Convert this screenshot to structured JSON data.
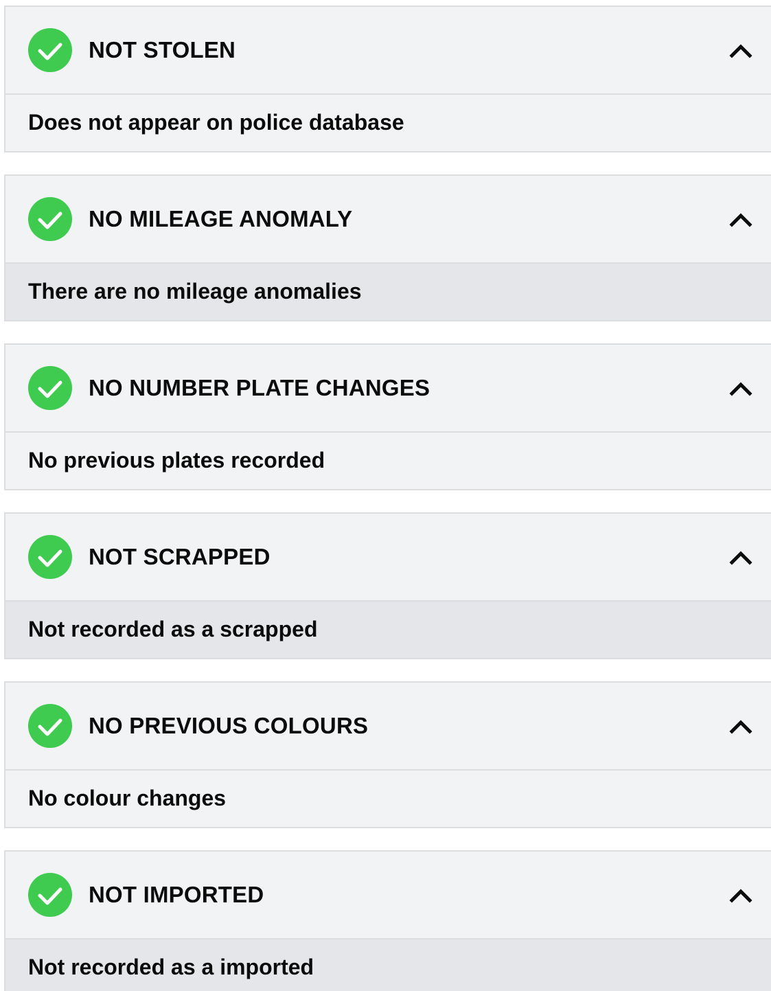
{
  "colors": {
    "check_green": "#3ecb4f",
    "header_bg": "#f2f3f5",
    "body_shaded_bg": "#e5e6e9",
    "border": "#dcdddf",
    "text": "#0b0c0c"
  },
  "checks": [
    {
      "title": "NOT STOLEN",
      "detail": "Does not appear on police database",
      "status_icon": "check-circle-icon",
      "toggle_icon": "chevron-up-icon",
      "expanded": true
    },
    {
      "title": "NO MILEAGE ANOMALY",
      "detail": "There are no mileage anomalies",
      "status_icon": "check-circle-icon",
      "toggle_icon": "chevron-up-icon",
      "expanded": true
    },
    {
      "title": "NO NUMBER PLATE CHANGES",
      "detail": "No previous plates recorded",
      "status_icon": "check-circle-icon",
      "toggle_icon": "chevron-up-icon",
      "expanded": true
    },
    {
      "title": "NOT SCRAPPED",
      "detail": "Not recorded as a scrapped",
      "status_icon": "check-circle-icon",
      "toggle_icon": "chevron-up-icon",
      "expanded": true
    },
    {
      "title": "NO PREVIOUS COLOURS",
      "detail": "No colour changes",
      "status_icon": "check-circle-icon",
      "toggle_icon": "chevron-up-icon",
      "expanded": true
    },
    {
      "title": "NOT IMPORTED",
      "detail": "Not recorded as a imported",
      "status_icon": "check-circle-icon",
      "toggle_icon": "chevron-up-icon",
      "expanded": true
    }
  ]
}
